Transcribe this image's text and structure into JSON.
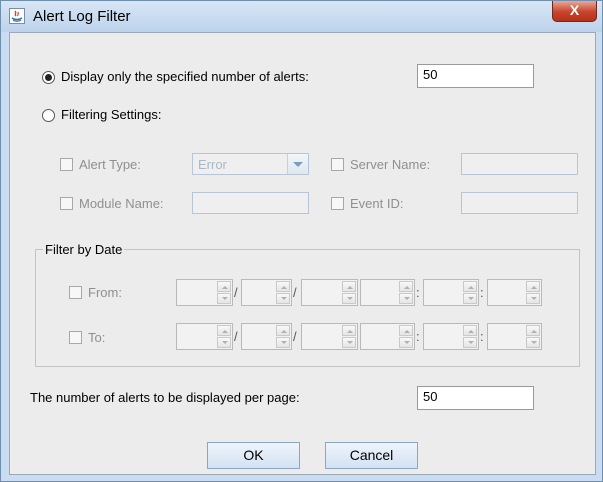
{
  "window": {
    "title": "Alert Log Filter",
    "close_label": "X"
  },
  "display_option": {
    "label": "Display only the specified number of alerts:",
    "value": "50",
    "selected": true
  },
  "filter_option": {
    "label": "Filtering Settings:",
    "selected": false
  },
  "alert_type": {
    "label": "Alert Type:",
    "selected_value": "Error"
  },
  "server_name": {
    "label": "Server Name:",
    "value": ""
  },
  "module_name": {
    "label": "Module Name:",
    "value": ""
  },
  "event_id": {
    "label": "Event ID:",
    "value": ""
  },
  "date_filter": {
    "title": "Filter by Date",
    "from_label": "From:",
    "to_label": "To:",
    "separators": [
      "/",
      "/",
      ":",
      ":"
    ]
  },
  "per_page": {
    "label": "The number of alerts to be displayed per page:",
    "value": "50"
  },
  "buttons": {
    "ok": "OK",
    "cancel": "Cancel"
  }
}
